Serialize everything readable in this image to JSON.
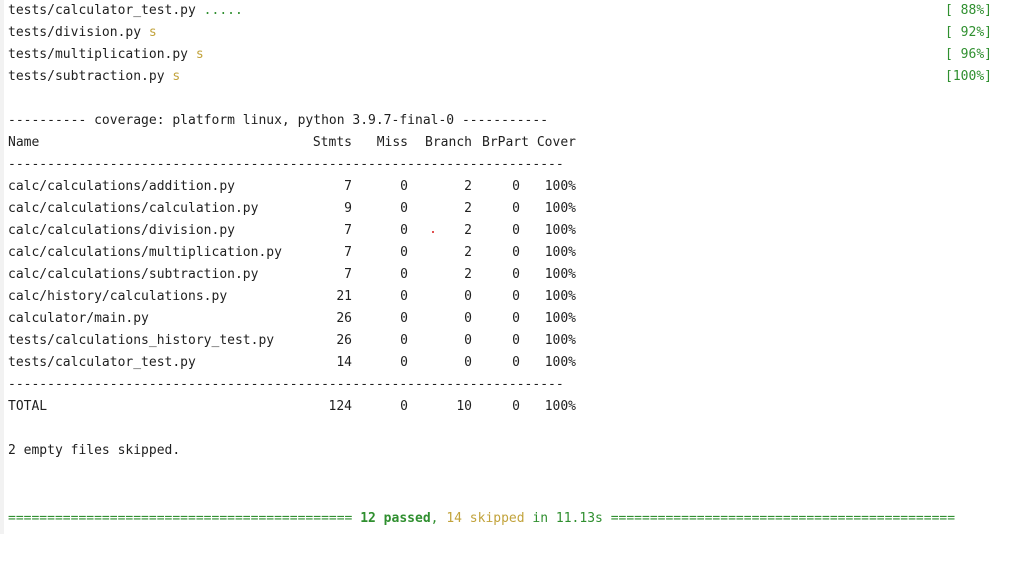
{
  "test_results": [
    {
      "file": "tests/calculator_test.py",
      "marks": ".....",
      "marks_type": "pass",
      "percent": "[ 88%]"
    },
    {
      "file": "tests/division.py",
      "marks": "s",
      "marks_type": "skip",
      "percent": "[ 92%]"
    },
    {
      "file": "tests/multiplication.py",
      "marks": "s",
      "marks_type": "skip",
      "percent": "[ 96%]"
    },
    {
      "file": "tests/subtraction.py",
      "marks": "s",
      "marks_type": "skip",
      "percent": "[100%]"
    }
  ],
  "coverage_header": "---------- coverage: platform linux, python 3.9.7-final-0 -----------",
  "columns": {
    "name": "Name",
    "stmts": "Stmts",
    "miss": "Miss",
    "branch": "Branch",
    "brpart": "BrPart",
    "cover": "Cover"
  },
  "separator": "-----------------------------------------------------------------------",
  "rows": [
    {
      "name": "calc/calculations/addition.py",
      "stmts": "7",
      "miss": "0",
      "branch": "2",
      "brpart": "0",
      "cover": "100%"
    },
    {
      "name": "calc/calculations/calculation.py",
      "stmts": "9",
      "miss": "0",
      "branch": "2",
      "brpart": "0",
      "cover": "100%"
    },
    {
      "name": "calc/calculations/division.py",
      "stmts": "7",
      "miss": "0",
      "branch": "2",
      "brpart": "0",
      "cover": "100%"
    },
    {
      "name": "calc/calculations/multiplication.py",
      "stmts": "7",
      "miss": "0",
      "branch": "2",
      "brpart": "0",
      "cover": "100%"
    },
    {
      "name": "calc/calculations/subtraction.py",
      "stmts": "7",
      "miss": "0",
      "branch": "2",
      "brpart": "0",
      "cover": "100%"
    },
    {
      "name": "calc/history/calculations.py",
      "stmts": "21",
      "miss": "0",
      "branch": "0",
      "brpart": "0",
      "cover": "100%"
    },
    {
      "name": "calculator/main.py",
      "stmts": "26",
      "miss": "0",
      "branch": "0",
      "brpart": "0",
      "cover": "100%"
    },
    {
      "name": "tests/calculations_history_test.py",
      "stmts": "26",
      "miss": "0",
      "branch": "0",
      "brpart": "0",
      "cover": "100%"
    },
    {
      "name": "tests/calculator_test.py",
      "stmts": "14",
      "miss": "0",
      "branch": "0",
      "brpart": "0",
      "cover": "100%"
    }
  ],
  "total": {
    "name": "TOTAL",
    "stmts": "124",
    "miss": "0",
    "branch": "10",
    "brpart": "0",
    "cover": "100%"
  },
  "skipped_note": "2 empty files skipped.",
  "summary": {
    "left_rule": "============================================ ",
    "passed": "12 passed",
    "comma": ", ",
    "skipped": "14 skipped",
    "in_time": " in 11.13s ",
    "right_rule": "============================================"
  },
  "colors": {
    "pass": "#2f8f2f",
    "skip": "#c2a33c"
  }
}
